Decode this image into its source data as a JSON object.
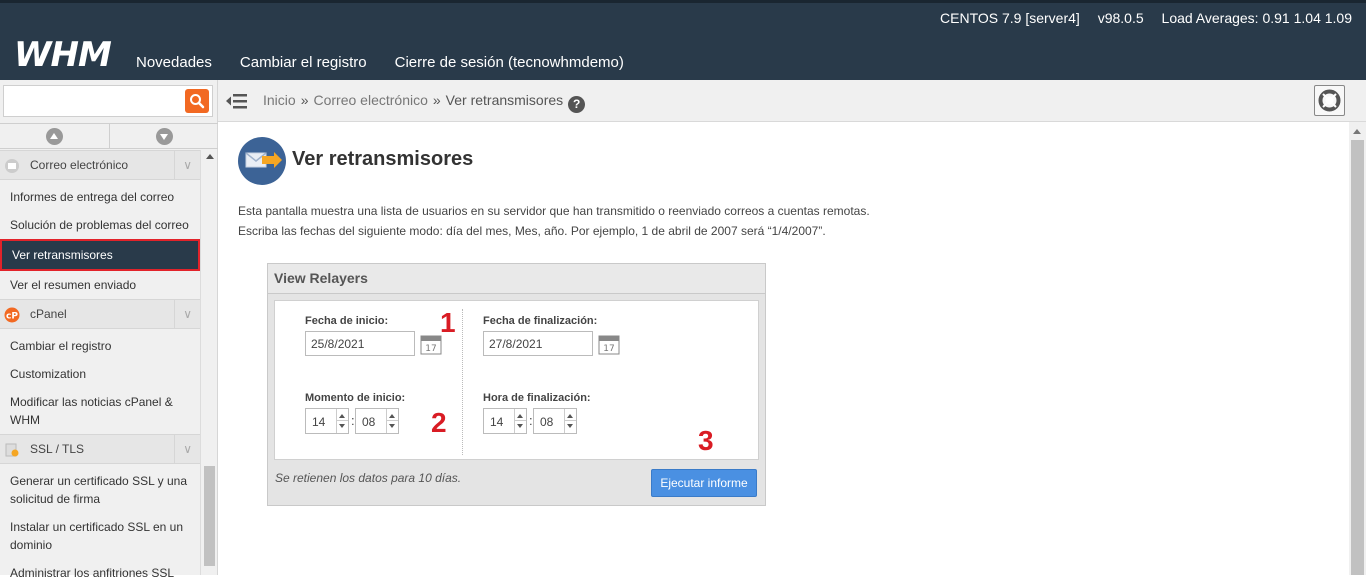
{
  "header": {
    "logo": "WHM",
    "os": "CENTOS 7.9 [server4]",
    "version": "v98.0.5",
    "load": "Load Averages: 0.91 1.04 1.09",
    "nav": [
      "Novedades",
      "Cambiar el registro",
      "Cierre de sesión (tecnowhmdemo)"
    ]
  },
  "search": {
    "value": "",
    "placeholder": ""
  },
  "sidebar": {
    "categories": [
      {
        "label": "Correo electrónico",
        "icon": "mail-icon",
        "items": [
          "Informes de entrega del correo",
          "Solución de problemas del correo",
          "Ver retransmisores",
          "Ver el resumen enviado"
        ]
      },
      {
        "label": "cPanel",
        "icon": "cpanel-icon",
        "items": [
          "Cambiar el registro",
          "Customization",
          "Modificar las noticias cPanel & WHM"
        ]
      },
      {
        "label": "SSL / TLS",
        "icon": "certificate-icon",
        "items": [
          "Generar un certificado SSL y una solicitud de firma",
          "Instalar un certificado SSL en un dominio",
          "Administrar los anfitriones SSL"
        ]
      }
    ],
    "active": "Ver retransmisores"
  },
  "breadcrumb": {
    "home": "Inicio",
    "section": "Correo electrónico",
    "current": "Ver retransmisores",
    "sep": "»"
  },
  "page": {
    "title": "Ver retransmisores",
    "desc1": "Esta pantalla muestra una lista de usuarios en su servidor que han transmitido o reenviado correos a cuentas remotas.",
    "desc2": "Escriba las fechas del siguiente modo: día del mes, Mes, año. Por ejemplo, 1 de abril de 2007 será “1/4/2007”."
  },
  "form": {
    "panel_title": "View Relayers",
    "start_date_label": "Fecha de inicio:",
    "start_date": "25/8/2021",
    "end_date_label": "Fecha de finalización:",
    "end_date": "27/8/2021",
    "start_time_label": "Momento de inicio:",
    "start_hour": "14",
    "start_min": "08",
    "end_time_label": "Hora de finalización:",
    "end_hour": "14",
    "end_min": "08",
    "colon": ":",
    "calendar_day": "17",
    "retention": "Se retienen los datos para 10 días.",
    "run_button": "Ejecutar informe"
  },
  "annotations": [
    "1",
    "2",
    "3"
  ],
  "colors": {
    "header_bg": "#293a4a",
    "accent_orange": "#f26922",
    "annotation_red": "#d91c24",
    "button_blue": "#4a90e2"
  }
}
